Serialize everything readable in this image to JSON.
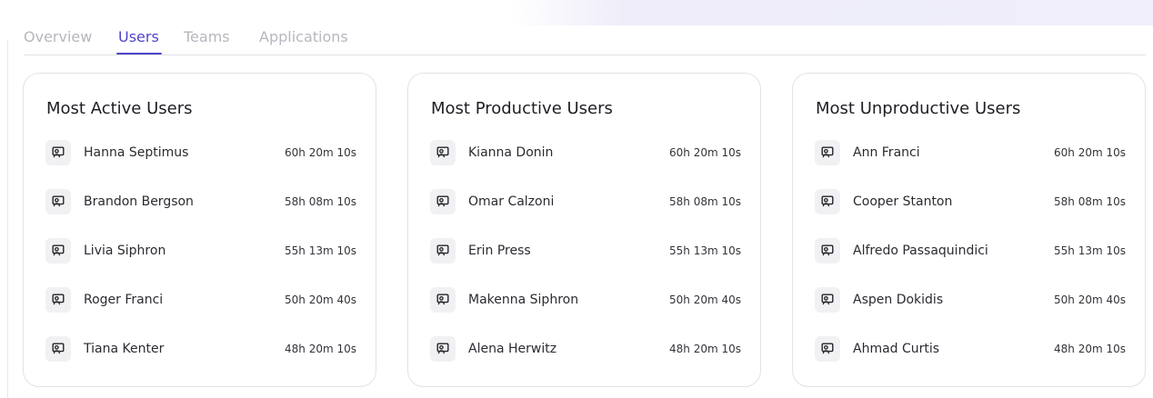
{
  "tabs": [
    {
      "label": "Overview",
      "active": false
    },
    {
      "label": "Users",
      "active": true
    },
    {
      "label": "Teams",
      "active": false
    },
    {
      "label": "Applications",
      "active": false
    }
  ],
  "colors": {
    "accent": "#4e45c9",
    "inactive_tab": "#b6b7bf",
    "card_border": "#e2e2e8",
    "icon_chip": "#f1f1f4"
  },
  "cards": [
    {
      "title": "Most Active Users",
      "rows": [
        {
          "icon": "user-monitor-icon",
          "name": "Hanna Septimus",
          "time": "60h 20m 10s"
        },
        {
          "icon": "user-monitor-icon",
          "name": "Brandon Bergson",
          "time": "58h 08m 10s"
        },
        {
          "icon": "user-monitor-icon",
          "name": "Livia Siphron",
          "time": "55h 13m 10s"
        },
        {
          "icon": "user-monitor-icon",
          "name": "Roger Franci",
          "time": "50h 20m 40s"
        },
        {
          "icon": "user-monitor-icon",
          "name": "Tiana Kenter",
          "time": "48h 20m 10s"
        }
      ]
    },
    {
      "title": "Most Productive Users",
      "rows": [
        {
          "icon": "user-monitor-icon",
          "name": "Kianna Donin",
          "time": "60h 20m 10s"
        },
        {
          "icon": "user-monitor-icon",
          "name": "Omar Calzoni",
          "time": "58h 08m 10s"
        },
        {
          "icon": "user-monitor-icon",
          "name": "Erin Press",
          "time": "55h 13m 10s"
        },
        {
          "icon": "user-monitor-icon",
          "name": "Makenna Siphron",
          "time": "50h 20m 40s"
        },
        {
          "icon": "user-monitor-icon",
          "name": "Alena Herwitz",
          "time": "48h 20m 10s"
        }
      ]
    },
    {
      "title": "Most Unproductive Users",
      "rows": [
        {
          "icon": "user-monitor-icon",
          "name": "Ann Franci",
          "time": "60h 20m 10s"
        },
        {
          "icon": "user-monitor-icon",
          "name": "Cooper Stanton",
          "time": "58h 08m 10s"
        },
        {
          "icon": "user-monitor-icon",
          "name": "Alfredo Passaquindici",
          "time": "55h 13m 10s"
        },
        {
          "icon": "user-monitor-icon",
          "name": "Aspen Dokidis",
          "time": "50h 20m 40s"
        },
        {
          "icon": "user-monitor-icon",
          "name": "Ahmad Curtis",
          "time": "48h 20m 10s"
        }
      ]
    }
  ]
}
